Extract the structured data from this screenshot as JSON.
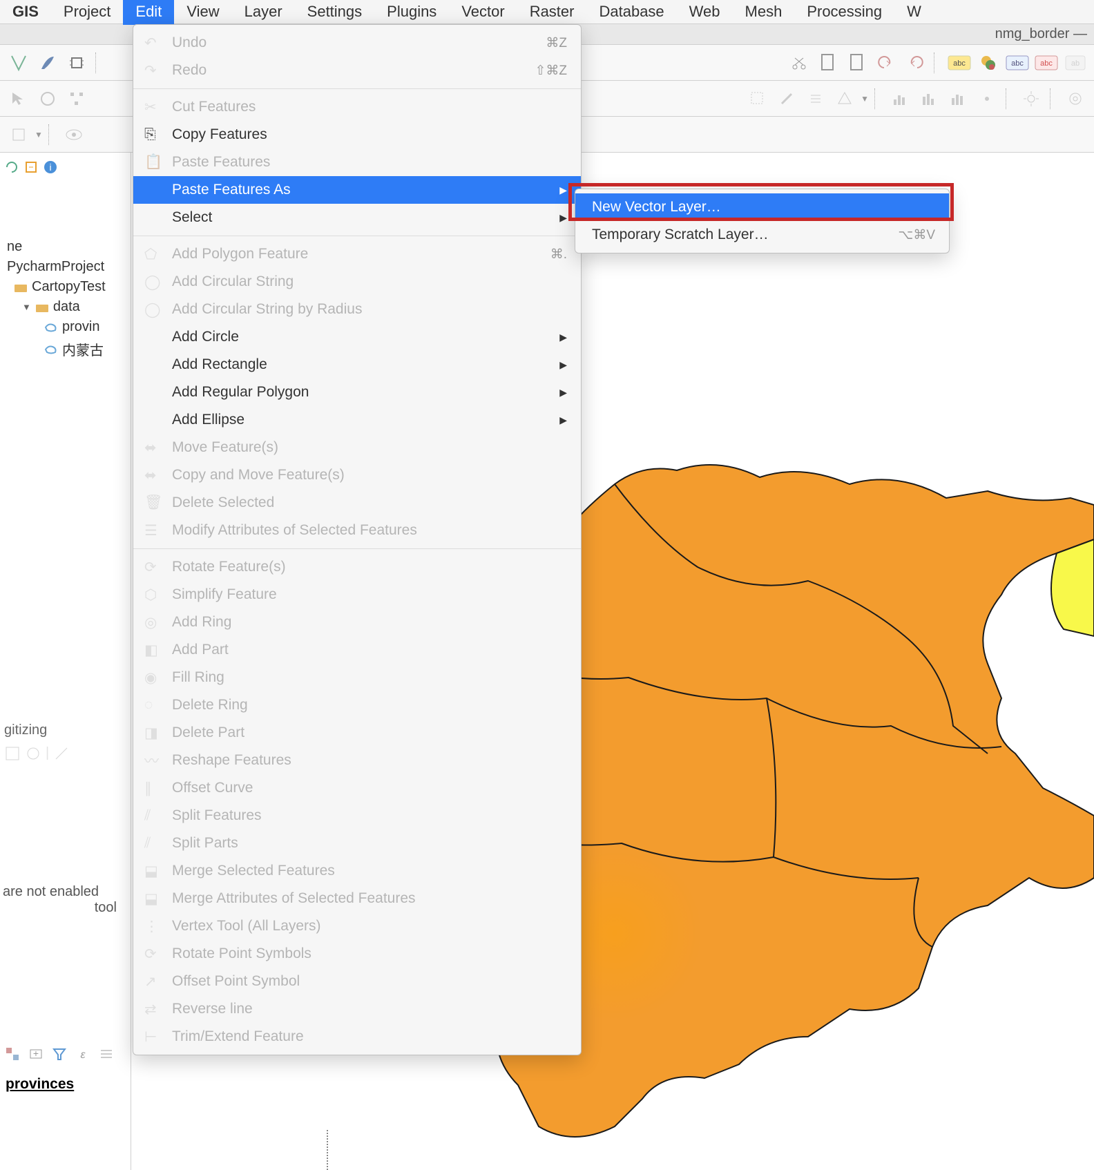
{
  "menubar": {
    "items": [
      "GIS",
      "Project",
      "Edit",
      "View",
      "Layer",
      "Settings",
      "Plugins",
      "Vector",
      "Raster",
      "Database",
      "Web",
      "Mesh",
      "Processing",
      "W"
    ],
    "active_index": 2
  },
  "window": {
    "title": "nmg_border —"
  },
  "toolbar1_icons": [
    "open-icon",
    "save-icon",
    "new-icon",
    "sep",
    "zoom-icon",
    "zoom-out-icon",
    "sep",
    "layer-icon",
    "raster-icon",
    "sep",
    "refresh-icon",
    "undo-icon",
    "print-icon",
    "sep",
    "abc-yellow-icon",
    "color-circle-icon",
    "abc-blue-icon",
    "abc-red-icon",
    "ab-gray-icon"
  ],
  "toolbar2_icons": [
    "select-icon",
    "move-icon",
    "node-icon",
    "sep",
    "dropdown-icon",
    "sep",
    "cut-icon",
    "brush-icon",
    "align-icon",
    "shape-icon",
    "menu-down-icon",
    "sep",
    "hist-icon",
    "hist2-icon",
    "hist3-icon",
    "dot-icon",
    "sep",
    "sun-icon",
    "sep",
    "target-icon"
  ],
  "toolbar3_icons": [
    "box-icon",
    "dropdown2-icon",
    "sep",
    "eye-icon"
  ],
  "side_tools": [
    "t1",
    "t2",
    "filter-icon",
    "expr-icon",
    "list-icon"
  ],
  "tree": {
    "items": [
      {
        "label": "ne",
        "indent": 0,
        "icon": "none"
      },
      {
        "label": "PycharmProject",
        "indent": 0,
        "icon": "folder",
        "arrow": "▶"
      },
      {
        "label": "CartopyTest",
        "indent": 1,
        "icon": "folder",
        "arrow": "▶"
      },
      {
        "label": "data",
        "indent": 2,
        "icon": "folder",
        "arrow": "▼"
      },
      {
        "label": "provin",
        "indent": 3,
        "icon": "layer"
      },
      {
        "label": "内蒙古",
        "indent": 3,
        "icon": "layer"
      }
    ]
  },
  "edit_menu": [
    {
      "type": "item",
      "icon": "undo-icon",
      "label": "Undo",
      "shortcut": "⌘Z",
      "disabled": true
    },
    {
      "type": "item",
      "icon": "redo-icon",
      "label": "Redo",
      "shortcut": "⇧⌘Z",
      "disabled": true
    },
    {
      "type": "sep"
    },
    {
      "type": "item",
      "icon": "scissors-icon",
      "label": "Cut Features",
      "disabled": true
    },
    {
      "type": "item",
      "icon": "copy-icon",
      "label": "Copy Features"
    },
    {
      "type": "item",
      "icon": "paste-icon",
      "label": "Paste Features",
      "disabled": true
    },
    {
      "type": "item",
      "label": "Paste Features As",
      "sub": true,
      "highlighted": true
    },
    {
      "type": "item",
      "label": "Select",
      "sub": true
    },
    {
      "type": "sep"
    },
    {
      "type": "item",
      "icon": "polygon-icon",
      "label": "Add Polygon Feature",
      "shortcut": "⌘.",
      "disabled": true
    },
    {
      "type": "item",
      "icon": "circle-string-icon",
      "label": "Add Circular String",
      "disabled": true
    },
    {
      "type": "item",
      "icon": "circle-radius-icon",
      "label": "Add Circular String by Radius",
      "disabled": true
    },
    {
      "type": "item",
      "label": "Add Circle",
      "sub": true
    },
    {
      "type": "item",
      "label": "Add Rectangle",
      "sub": true
    },
    {
      "type": "item",
      "label": "Add Regular Polygon",
      "sub": true
    },
    {
      "type": "item",
      "label": "Add Ellipse",
      "sub": true
    },
    {
      "type": "item",
      "icon": "move-feat-icon",
      "label": "Move Feature(s)",
      "disabled": true
    },
    {
      "type": "item",
      "icon": "copy-move-icon",
      "label": "Copy and Move Feature(s)",
      "disabled": true
    },
    {
      "type": "item",
      "icon": "trash-icon",
      "label": "Delete Selected",
      "disabled": true
    },
    {
      "type": "item",
      "icon": "modify-attr-icon",
      "label": "Modify Attributes of Selected Features",
      "disabled": true
    },
    {
      "type": "sep"
    },
    {
      "type": "item",
      "icon": "rotate-icon",
      "label": "Rotate Feature(s)",
      "disabled": true
    },
    {
      "type": "item",
      "icon": "simplify-icon",
      "label": "Simplify Feature",
      "disabled": true
    },
    {
      "type": "item",
      "icon": "add-ring-icon",
      "label": "Add Ring",
      "disabled": true
    },
    {
      "type": "item",
      "icon": "add-part-icon",
      "label": "Add Part",
      "disabled": true
    },
    {
      "type": "item",
      "icon": "fill-ring-icon",
      "label": "Fill Ring",
      "disabled": true
    },
    {
      "type": "item",
      "icon": "del-ring-icon",
      "label": "Delete Ring",
      "disabled": true
    },
    {
      "type": "item",
      "icon": "del-part-icon",
      "label": "Delete Part",
      "disabled": true
    },
    {
      "type": "item",
      "icon": "reshape-icon",
      "label": "Reshape Features",
      "disabled": true
    },
    {
      "type": "item",
      "icon": "offset-icon",
      "label": "Offset Curve",
      "disabled": true
    },
    {
      "type": "item",
      "icon": "split-icon",
      "label": "Split Features",
      "disabled": true
    },
    {
      "type": "item",
      "icon": "split-parts-icon",
      "label": "Split Parts",
      "disabled": true
    },
    {
      "type": "item",
      "icon": "merge-icon",
      "label": "Merge Selected Features",
      "disabled": true
    },
    {
      "type": "item",
      "icon": "merge-attr-icon",
      "label": "Merge Attributes of Selected Features",
      "disabled": true
    },
    {
      "type": "item",
      "icon": "vertex-icon",
      "label": "Vertex Tool (All Layers)",
      "disabled": true
    },
    {
      "type": "item",
      "icon": "rotate-pt-icon",
      "label": "Rotate Point Symbols",
      "disabled": true
    },
    {
      "type": "item",
      "icon": "offset-pt-icon",
      "label": "Offset Point Symbol",
      "disabled": true
    },
    {
      "type": "item",
      "icon": "reverse-icon",
      "label": "Reverse line",
      "disabled": true
    },
    {
      "type": "item",
      "icon": "trim-icon",
      "label": "Trim/Extend Feature",
      "disabled": true
    }
  ],
  "submenu": [
    {
      "label": "New Vector Layer…",
      "highlighted": true
    },
    {
      "label": "Temporary Scratch Layer…",
      "shortcut": "⌥⌘V"
    }
  ],
  "digitizing": {
    "title": "gitizing"
  },
  "not_enabled": {
    "line1": "are not enabled",
    "line2": "tool"
  },
  "bottom_layer": {
    "label": "provinces"
  }
}
